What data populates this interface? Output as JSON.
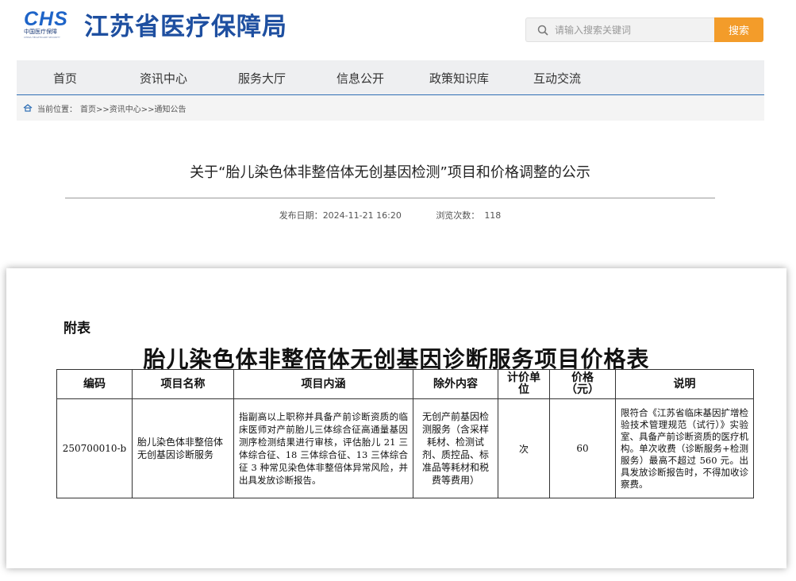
{
  "header": {
    "logo_mark": "CHS",
    "logo_org": "中国医疗保障",
    "logo_org_en": "CHINA HEALTHCARE SECURITY",
    "site_title": "江苏省医疗保障局",
    "search_placeholder": "请输入搜索关键词",
    "search_button": "搜索"
  },
  "nav": {
    "items": [
      "首页",
      "资讯中心",
      "服务大厅",
      "信息公开",
      "政策知识库",
      "互动交流"
    ]
  },
  "breadcrumb": {
    "label": "当前位置：",
    "path": "首页>>资讯中心>>通知公告"
  },
  "article": {
    "title": "关于“胎儿染色体非整倍体无创基因检测”项目和价格调整的公示",
    "publish_label": "发布日期：",
    "publish_date": "2024-11-21 16:20",
    "views_label": "浏览次数：",
    "views": "118"
  },
  "attachment": {
    "label": "附表",
    "heading": "胎儿染色体非整倍体无创基因诊断服务项目价格表",
    "columns": [
      "编码",
      "项目名称",
      "项目内涵",
      "除外内容",
      "计价单位",
      "价格（元）",
      "说明"
    ],
    "row": {
      "code": "250700010-b",
      "name": "胎儿染色体非整倍体无创基因诊断服务",
      "content": "指副高以上职称并具备产前诊断资质的临床医师对产前胎儿三体综合征高通量基因测序检测结果进行审核，评估胎儿 21 三体综合征、18 三体综合征、13 三体综合征 3 种常见染色体非整倍体异常风险，并出具发放诊断报告。",
      "excluded": "无创产前基因检测服务（含采样耗材、检测试剂、质控品、标准品等耗材和税费等费用）",
      "unit": "次",
      "price": "60",
      "note": "限符合《江苏省临床基因扩增检验技术管理规范（试行）》实验室、具备产前诊断资质的医疗机构。单次收费（诊断服务+检测服务）最高不超过 560 元。出具发放诊断报告时，不得加收诊察费。"
    }
  },
  "colors": {
    "brand_blue": "#1e4fa0",
    "search_orange": "#f39c2a",
    "nav_rule": "#2f6fb5"
  }
}
